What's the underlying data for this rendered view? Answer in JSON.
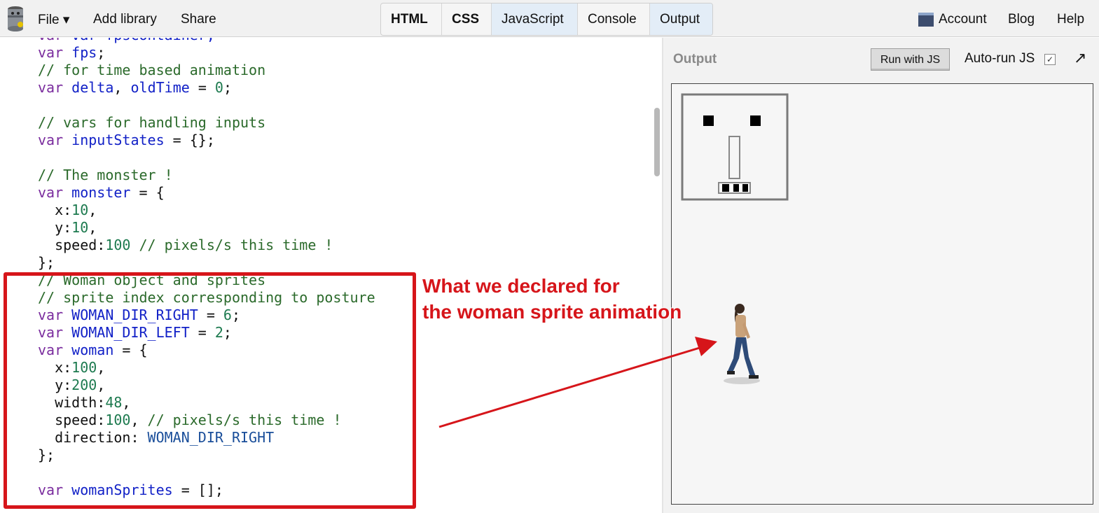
{
  "menubar": {
    "file": "File ▾",
    "add_library": "Add library",
    "share": "Share",
    "tabs": [
      "HTML",
      "CSS",
      "JavaScript",
      "Console",
      "Output"
    ],
    "account": "Account",
    "blog": "Blog",
    "help": "Help"
  },
  "editor": {
    "lines": [
      "var fpsContainer;",
      "var fps;",
      "// for time based animation",
      "var delta, oldTime = 0;",
      "",
      "// vars for handling inputs",
      "var inputStates = {};",
      "",
      "// The monster !",
      "var monster = {",
      "  x:10,",
      "  y:10,",
      "  speed:100 // pixels/s this time !",
      "};",
      "// Woman object and sprites",
      "// sprite index corresponding to posture",
      "var WOMAN_DIR_RIGHT = 6;",
      "var WOMAN_DIR_LEFT = 2;",
      "var woman = {",
      "  x:100,",
      "  y:200,",
      "  width:48,",
      "  speed:100, // pixels/s this time !",
      "  direction: WOMAN_DIR_RIGHT",
      "};",
      "",
      "var womanSprites = [];"
    ]
  },
  "output": {
    "title": "Output",
    "run_button": "Run with JS",
    "autorun_label": "Auto-run JS",
    "autorun_checked": true,
    "expand_icon": "↗"
  },
  "annotation": {
    "text": "What we declared for\nthe woman sprite animation",
    "color": "#d6151a"
  }
}
